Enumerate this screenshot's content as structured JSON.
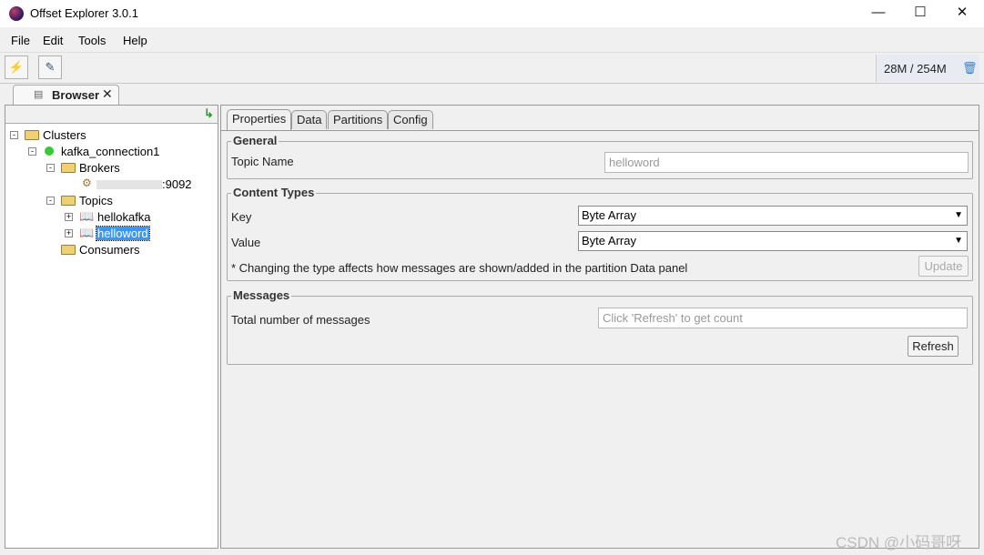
{
  "window": {
    "title": "Offset Explorer  3.0.1"
  },
  "menu": [
    "File",
    "Edit",
    "Tools",
    "Help"
  ],
  "memory": "28M / 254M",
  "browser_tab": "Browser",
  "tree": {
    "root": "Clusters",
    "connection": "kafka_connection1",
    "brokers": "Brokers",
    "broker": ":9092",
    "topics": "Topics",
    "topic_items": [
      "hellokafka",
      "helloword"
    ],
    "consumers": "Consumers"
  },
  "tabs": [
    "Properties",
    "Data",
    "Partitions",
    "Config"
  ],
  "general": {
    "title": "General",
    "topic_name_label": "Topic Name",
    "topic_name_value": "helloword"
  },
  "content_types": {
    "title": "Content Types",
    "key_label": "Key",
    "key_value": "Byte Array",
    "value_label": "Value",
    "value_value": "Byte Array",
    "note": "* Changing the type affects how messages are shown/added in the partition Data panel",
    "update": "Update"
  },
  "messages": {
    "title": "Messages",
    "total_label": "Total number of messages",
    "total_placeholder": "Click 'Refresh' to get count",
    "refresh": "Refresh"
  },
  "watermark": "CSDN @小码哥呀"
}
